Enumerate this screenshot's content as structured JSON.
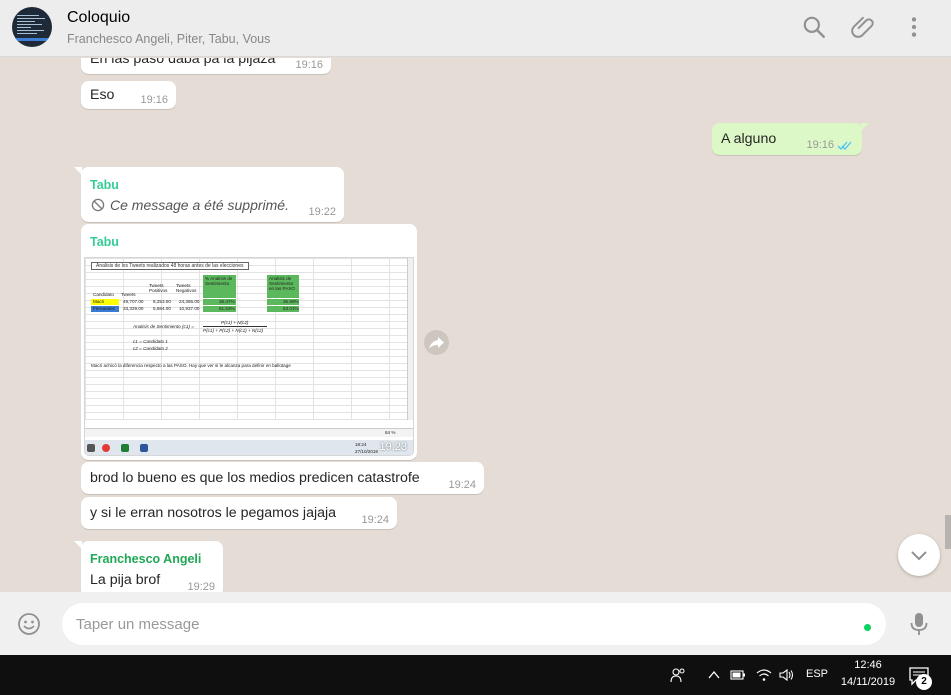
{
  "header": {
    "title": "Coloquio",
    "participants": "Franchesco Angeli, Piter, Tabu, Vous",
    "icons": [
      "search-icon",
      "attach-icon",
      "menu-icon"
    ]
  },
  "messages": [
    {
      "text": "En las paso daba pa la pijaza",
      "time": "19:16"
    },
    {
      "text": "Eso",
      "time": "19:16"
    },
    {
      "text": "A alguno",
      "time": "19:16",
      "status": "read"
    },
    {
      "sender": "Tabu",
      "sender_color": "#35cd96",
      "text": "Ce message a été supprimé.",
      "time": "19:22"
    },
    {
      "sender": "Tabu",
      "sender_color": "#35cd96",
      "time": "19:23"
    },
    {
      "text": "brod lo bueno es que los medios predicen catastrofe",
      "time": "19:24"
    },
    {
      "text": "y si le erran nosotros le pegamos jajaja",
      "time": "19:24"
    },
    {
      "sender": "Franchesco Angeli",
      "sender_color": "#1fa855",
      "text": "La pija brof",
      "time": "19:29"
    }
  ],
  "sheet": {
    "caption": "Analisis de los Tweets realizados 48 horas antes de las elecciones",
    "headers": [
      "Candidato",
      "Tweets",
      "Tweets Positivos",
      "Tweets Negativos",
      "% Analisis de Sentimiento",
      "Analisis de Sentimiento en las PASO"
    ],
    "rows": [
      [
        "Macri",
        "49,707.00",
        "8,253.00",
        "24,366.00",
        "38.47%",
        "36.99%"
      ],
      [
        "Fernandez",
        "33,329.00",
        "5,684.00",
        "10,937.00",
        "61.53%",
        "63.01%"
      ]
    ],
    "formula_label": "Analisis de Sentimiento (c1) =",
    "formula_num": "P(c1) + N(c2)",
    "formula_den": "P(c1) + P(c2) + N(c1) + N(c2)",
    "c1_def": "c1 = Candidato 1",
    "c2_def": "c2 = Candidato 2",
    "note": "Macri achicó la diferencia respecto a las PASO. Hay que ver si le alcanza para definir en ballotage",
    "zoom": "84 %",
    "clock": "18:24",
    "date": "27/10/2019"
  },
  "compose": {
    "placeholder": "Taper un message"
  },
  "taskbar": {
    "lang": "ESP",
    "time": "12:46",
    "date": "14/11/2019",
    "notifications": "2"
  },
  "colors": {
    "background": "#e5ddd5",
    "outgoing": "#dcf8c6",
    "incoming": "#ffffff",
    "read_ticks": "#4fc3f7",
    "taskbar": "#0f0f0f"
  }
}
